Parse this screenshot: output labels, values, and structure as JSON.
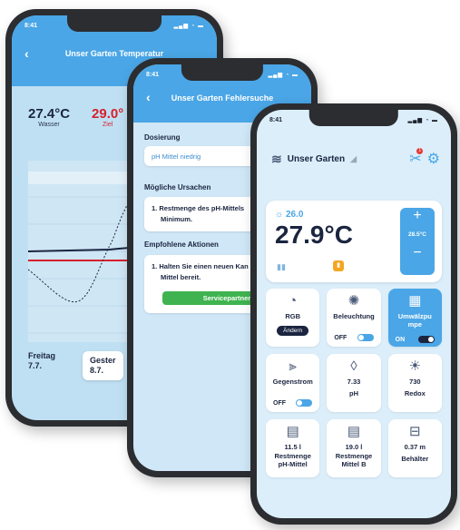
{
  "colors": {
    "accent": "#4aa6e6",
    "target_red": "#d8202c",
    "dark": "#1b2540",
    "green": "#3fb34f"
  },
  "phone_temperature": {
    "time": "8:41",
    "title": "Unser Garten Temperatur",
    "back_icon": "‹",
    "water_value": "27.4°C",
    "water_label": "Wasser",
    "target_value": "29.0°",
    "target_label": "Ziel",
    "date_friday": "Freitag",
    "date_friday_num": "7.7.",
    "date_yesterday": "Gester",
    "date_yesterday_num": "8.7."
  },
  "phone_troubleshoot": {
    "time": "8:41",
    "title": "Unser Garten Fehlersuche",
    "back_icon": "‹",
    "dosing_title": "Dosierung",
    "dosing_value": "pH Mittel niedrig",
    "causes_title": "Mögliche Ursachen",
    "cause_1a": "1.  Restmenge des pH-Mittels",
    "cause_1b": "Minimum.",
    "actions_title": "Empfohlene Aktionen",
    "action_1a": "1.  Halten Sie einen neuen Kan",
    "action_1b": "Mittel bereit.",
    "service_button": "Servicepartner konta"
  },
  "phone_main": {
    "time": "8:41",
    "garden_name": "Unser Garten",
    "notification_count": "1",
    "sun_temp": "26.0",
    "water_temp": "27.9°C",
    "setpoint": "28.5°C",
    "plus": "+",
    "minus": "−",
    "tiles": [
      {
        "label": "RGB",
        "button": "Ändern"
      },
      {
        "label": "Beleuchtung",
        "state": "OFF"
      },
      {
        "label": "Umwälzpu",
        "label2": "mpe",
        "state": "ON"
      },
      {
        "label": "Gegenstrom",
        "state": "OFF"
      },
      {
        "value": "7.33",
        "label": "pH"
      },
      {
        "value": "730",
        "label": "Redox"
      },
      {
        "value": "11.5 l",
        "label": "Restmenge",
        "label2": "pH-Mittel"
      },
      {
        "value": "19.0 l",
        "label": "Restmenge",
        "label2": "Mittel B"
      },
      {
        "value": "0.37 m",
        "label": "Behälter"
      }
    ]
  }
}
